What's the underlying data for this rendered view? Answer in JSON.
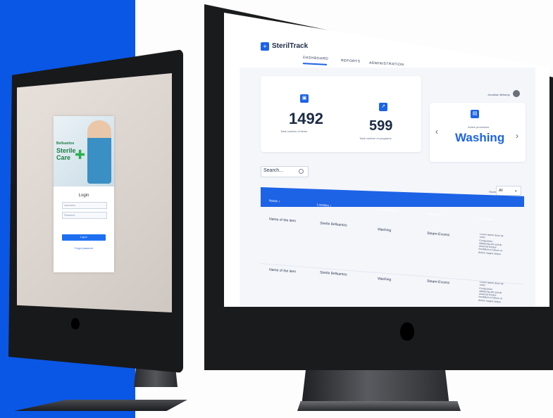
{
  "colors": {
    "brand_blue": "#1d63e6",
    "panel_blue": "#0a57e6",
    "bezel": "#18191b"
  },
  "login_screen": {
    "brand_line1": "Bellsantos",
    "brand_line2": "Sterile",
    "brand_line3": "Care",
    "title": "Login",
    "field_1_placeholder": "Username",
    "field_2_placeholder": "Password",
    "button_label": "Log in",
    "forgot_link": "Forgot password"
  },
  "app": {
    "logo_icon": "plus-icon",
    "brand": "SterilTrack",
    "nav_tabs": [
      "DASHBOARD",
      "REPORTS",
      "ADMINISTRATION"
    ],
    "active_tab": "DASHBOARD",
    "user_name": "Jonathan Bellamy",
    "stats": [
      {
        "value": "1492",
        "label": "Total number of items",
        "icon": "box-icon"
      },
      {
        "value": "599",
        "label": "Total number of programs",
        "icon": "chart-icon"
      }
    ],
    "process_card": {
      "label": "Active processes",
      "value": "Washing",
      "icon": "calendar-icon"
    },
    "search_value": "Search...",
    "show_label": "Show",
    "show_value": "All",
    "table": {
      "columns": [
        "Name ↕",
        "Location ↕",
        "Current Step ↕",
        "Processes ↕",
        "Comments ↕"
      ],
      "rows": [
        {
          "name": "Name of the item",
          "location": "Sterile Bellsantos",
          "step": "Washing",
          "process": "Steam-Excess",
          "comments": [
            "Lorem ipsum dolor sit amet",
            "Consectetur adipiscing elit sed do eiusmod tempor",
            "Incididunt ut labore et dolore magna aliqua"
          ]
        },
        {
          "name": "Name of the item",
          "location": "Sterile Bellsantos",
          "step": "Washing",
          "process": "Steam-Excess",
          "comments": [
            "Lorem ipsum dolor sit amet",
            "Consectetur adipiscing elit sed do eiusmod tempor",
            "Incididunt ut labore et dolore magna aliqua"
          ]
        }
      ]
    }
  }
}
